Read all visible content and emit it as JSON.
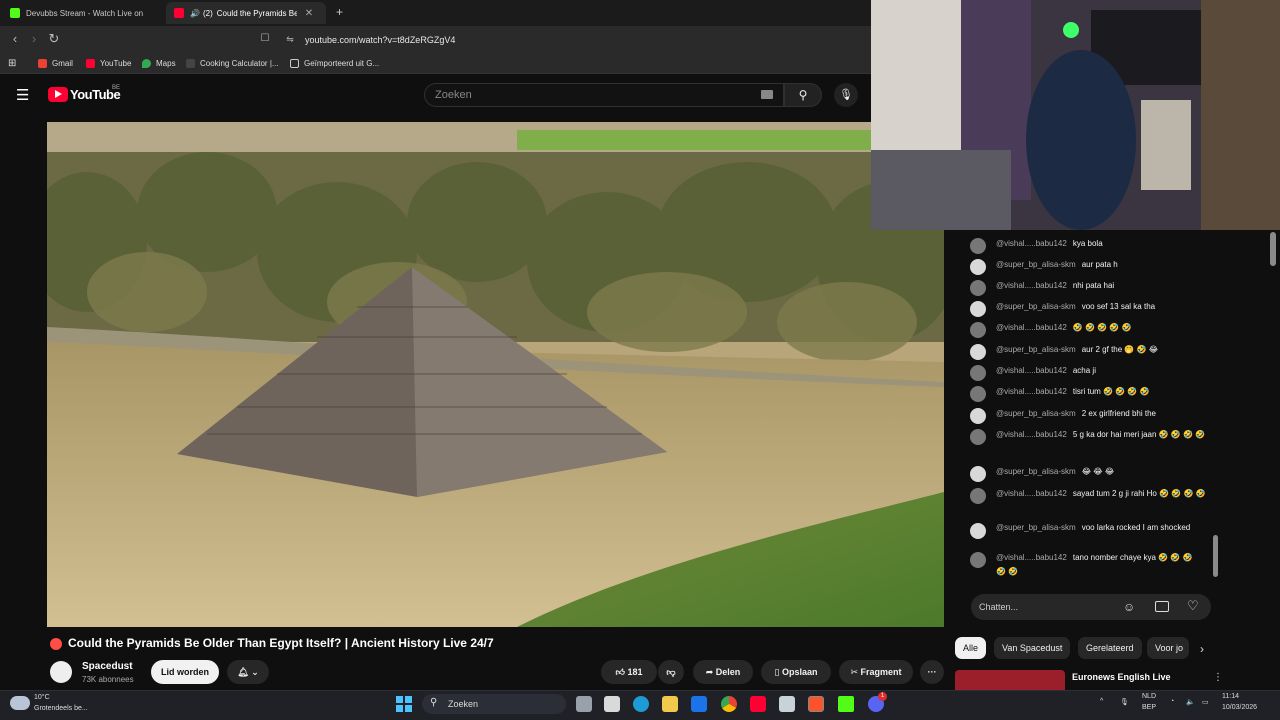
{
  "browser": {
    "tabs": [
      {
        "label": "Devubbs Stream - Watch Live on",
        "active": false,
        "favicon_color": "#53fc18"
      },
      {
        "label": "Could the Pyramids Be",
        "active": true,
        "badge": "(2)",
        "favicon_color": "#ff0033"
      }
    ],
    "new_tab": "+",
    "url": "youtube.com/watch?v=t8dZeRGZgV4",
    "bookmarks": [
      {
        "label": "Gmail",
        "icon": "gmail-icon",
        "color": "#ea4335"
      },
      {
        "label": "YouTube",
        "icon": "youtube-icon",
        "color": "#ff0033"
      },
      {
        "label": "Maps",
        "icon": "maps-icon",
        "color": "#34a853"
      },
      {
        "label": "Cooking Calculator |...",
        "icon": "calculator-icon",
        "color": "#444444"
      },
      {
        "label": "Geïmporteerd uit G...",
        "icon": "folder-icon",
        "color": "#cccccc"
      }
    ]
  },
  "youtube": {
    "logo": "YouTube",
    "region": "BE",
    "search_placeholder": "Zoeken"
  },
  "video": {
    "title": "Could the Pyramids Be Older Than Egypt Itself? | Ancient History Live 24/7",
    "channel": "Spacedust",
    "subscribers": "73K abonnees",
    "join_label": "Lid worden",
    "likes": "181",
    "share_label": "Delen",
    "save_label": "Opslaan",
    "clip_label": "Fragment",
    "more": "···"
  },
  "chat": {
    "messages": [
      {
        "user": "@vishal.....babu142",
        "text": "kya bola",
        "alt": false
      },
      {
        "user": "@super_bp_alisa-skm",
        "text": "aur pata h",
        "alt": true
      },
      {
        "user": "@vishal.....babu142",
        "text": "nhi pata hai",
        "alt": false
      },
      {
        "user": "@super_bp_alisa-skm",
        "text": "voo sef 13 sal ka tha",
        "alt": true
      },
      {
        "user": "@vishal.....babu142",
        "text": "🤣 🤣 🤣 🤣 🤣",
        "alt": false
      },
      {
        "user": "@super_bp_alisa-skm",
        "text": "aur 2 gf the 🤭 🤣 😂",
        "alt": true
      },
      {
        "user": "@vishal.....babu142",
        "text": "acha ji",
        "alt": false
      },
      {
        "user": "@vishal.....babu142",
        "text": "tisri tum 🤣 🤣 🤣 🤣",
        "alt": false
      },
      {
        "user": "@super_bp_alisa-skm",
        "text": "2 ex girlfriend bhi the",
        "alt": true
      },
      {
        "user": "@vishal.....babu142",
        "text": "5 g ka dor hai meri jaan 🤣 🤣 🤣 🤣",
        "alt": false
      },
      {
        "user": "@super_bp_alisa-skm",
        "text": "😂 😂 😂",
        "alt": true
      },
      {
        "user": "@vishal.....babu142",
        "text": "sayad tum 2 g ji rahi Ho 🤣 🤣 🤣 🤣",
        "alt": false
      },
      {
        "user": "@super_bp_alisa-skm",
        "text": "voo larka rocked I am shocked",
        "alt": true
      },
      {
        "user": "@vishal.....babu142",
        "text": "tano nomber chaye kya 🤣 🤣 🤣 🤣 🤣",
        "alt": false
      }
    ],
    "input_placeholder": "Chatten..."
  },
  "chips": [
    "Alle",
    "Van Spacedust",
    "Gerelateerd",
    "Voor jo"
  ],
  "related": {
    "title": "Euronews English Live"
  },
  "taskbar": {
    "weather_temp": "10°C",
    "weather_desc": "Grotendeels be...",
    "search_label": "Zoeken",
    "lang_top": "NLD",
    "lang_bottom": "BEP",
    "time": "11:14",
    "date": "10/03/2026",
    "notification_badge": "1"
  }
}
